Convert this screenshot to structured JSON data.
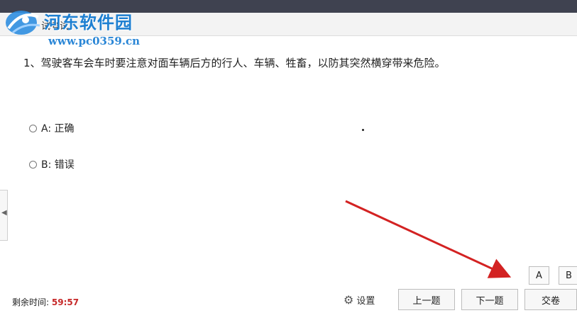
{
  "header": {
    "tab_label": "试考试"
  },
  "watermark": {
    "title": "河东软件园",
    "url": "www.pc0359.cn"
  },
  "question": {
    "text": "1、驾驶客车会车时要注意对面车辆后方的行人、车辆、牲畜，以防其突然横穿带来危险。",
    "options": [
      {
        "label": "A: 正确"
      },
      {
        "label": "B: 错误"
      }
    ]
  },
  "answer_buttons": [
    "A",
    "B"
  ],
  "footer": {
    "timer_label": "剩余时间:",
    "timer_value": "59:57",
    "settings_label": "设置",
    "prev_label": "上一题",
    "next_label": "下一题",
    "submit_label": "交卷"
  },
  "colors": {
    "titlebar": "#3f4250",
    "timer_value": "#c62828",
    "arrow": "#d32222",
    "watermark": "#1d7fd1"
  },
  "icons": {
    "settings": "gear-icon",
    "collapse": "chevron-left-icon"
  }
}
